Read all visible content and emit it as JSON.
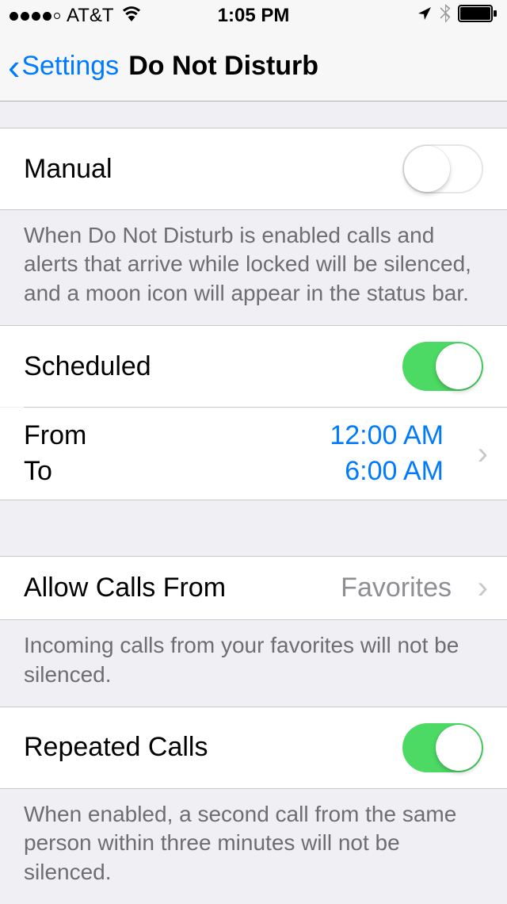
{
  "status_bar": {
    "carrier": "AT&T",
    "time": "1:05 PM"
  },
  "nav": {
    "back_label": "Settings",
    "title": "Do Not Disturb"
  },
  "rows": {
    "manual": {
      "label": "Manual",
      "footer": "When Do Not Disturb is enabled calls and alerts that arrive while locked will be silenced, and a moon icon will appear in the status bar."
    },
    "scheduled": {
      "label": "Scheduled",
      "from_label": "From",
      "to_label": "To",
      "from_value": "12:00 AM",
      "to_value": "6:00 AM"
    },
    "allow_calls": {
      "label": "Allow Calls From",
      "value": "Favorites",
      "footer": "Incoming calls from your favorites will not be silenced."
    },
    "repeated_calls": {
      "label": "Repeated Calls",
      "footer": "When enabled, a second call from the same person within three minutes will not be silenced."
    }
  }
}
